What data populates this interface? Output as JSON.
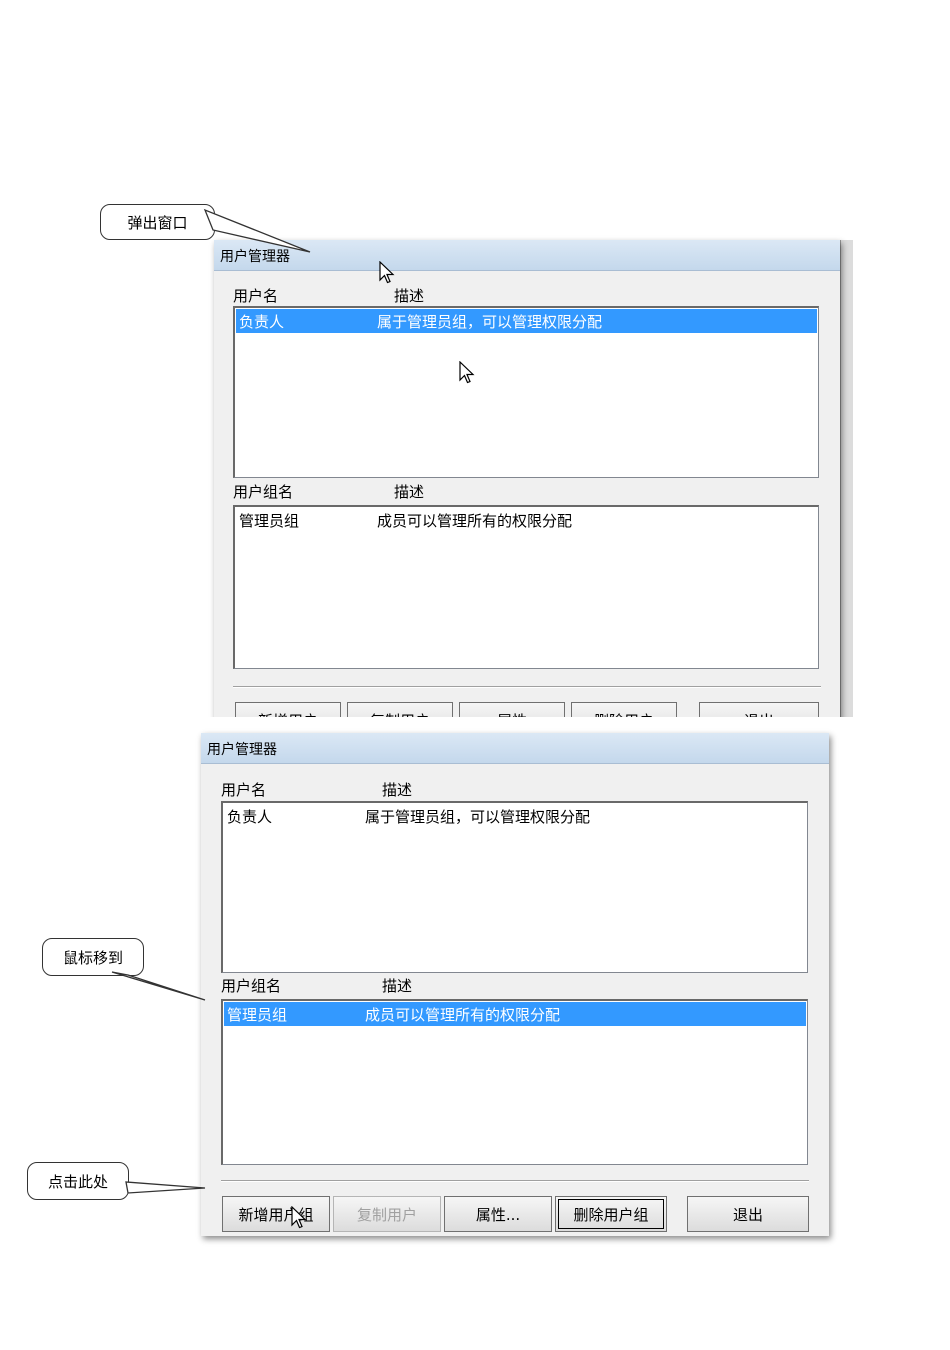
{
  "callouts": {
    "popup": "弹出窗口",
    "mouse_move": "鼠标移到",
    "click_here": "点击此处"
  },
  "window_top": {
    "title": "用户管理器",
    "user_header_name": "用户名",
    "user_header_desc": "描述",
    "users": [
      {
        "name": "负责人",
        "desc": "属于管理员组，可以管理权限分配",
        "selected": true
      }
    ],
    "group_header_name": "用户组名",
    "group_header_desc": "描述",
    "groups": [
      {
        "name": "管理员组",
        "desc": "成员可以管理所有的权限分配",
        "selected": false
      }
    ],
    "buttons": [
      "新增用户",
      "复制用户",
      "属性",
      "删除用户",
      "退出"
    ]
  },
  "window_bottom": {
    "title": "用户管理器",
    "user_header_name": "用户名",
    "user_header_desc": "描述",
    "users": [
      {
        "name": "负责人",
        "desc": "属于管理员组，可以管理权限分配",
        "selected": false
      }
    ],
    "group_header_name": "用户组名",
    "group_header_desc": "描述",
    "groups": [
      {
        "name": "管理员组",
        "desc": "成员可以管理所有的权限分配",
        "selected": true
      }
    ],
    "buttons": [
      {
        "label": "新增用户组",
        "state": "normal"
      },
      {
        "label": "复制用户",
        "state": "disabled"
      },
      {
        "label": "属性...",
        "state": "normal"
      },
      {
        "label": "删除用户组",
        "state": "focused"
      },
      {
        "label": "退出",
        "state": "normal"
      }
    ]
  },
  "icons": [
    "mouse-cursor-icon"
  ],
  "colors": {
    "selection": "#3399ff",
    "title_bar": "#c4d8ec",
    "window_bg": "#f0f0f0"
  }
}
